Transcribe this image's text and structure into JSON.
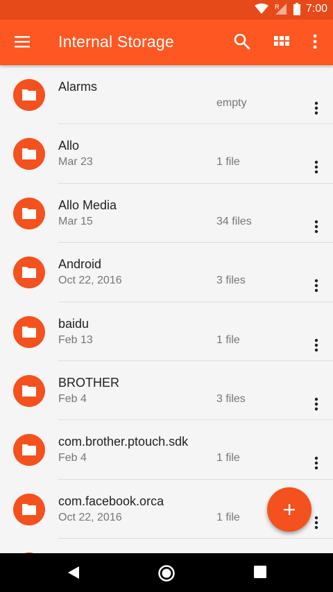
{
  "status_bar": {
    "time": "7:00",
    "icons": [
      "wifi-icon",
      "signal-roaming-icon",
      "battery-icon"
    ]
  },
  "app_bar": {
    "title": "Internal Storage",
    "icons": [
      "menu-icon",
      "search-icon",
      "grid-view-icon",
      "more-vert-icon"
    ]
  },
  "folders": [
    {
      "name": "Alarms",
      "date": "",
      "count": "empty"
    },
    {
      "name": "Allo",
      "date": "Mar 23",
      "count": "1 file"
    },
    {
      "name": "Allo Media",
      "date": "Mar 15",
      "count": "34 files"
    },
    {
      "name": "Android",
      "date": "Oct 22, 2016",
      "count": "3 files"
    },
    {
      "name": "baidu",
      "date": "Feb 13",
      "count": "1 file"
    },
    {
      "name": "BROTHER",
      "date": "Feb 4",
      "count": "3 files"
    },
    {
      "name": "com.brother.ptouch.sdk",
      "date": "Feb 4",
      "count": "1 file"
    },
    {
      "name": "com.facebook.orca",
      "date": "Oct 22, 2016",
      "count": "1 file"
    },
    {
      "name": "",
      "date": "",
      "count": ""
    }
  ],
  "fab": {
    "icon": "add-icon"
  },
  "nav_bar": {
    "icons": [
      "back-icon",
      "home-icon",
      "recents-icon"
    ]
  },
  "colors": {
    "status_bar": "#e64a19",
    "app_bar": "#ff5722",
    "accent": "#f4511e",
    "background": "#f5f5f5",
    "nav_bar": "#000000"
  }
}
